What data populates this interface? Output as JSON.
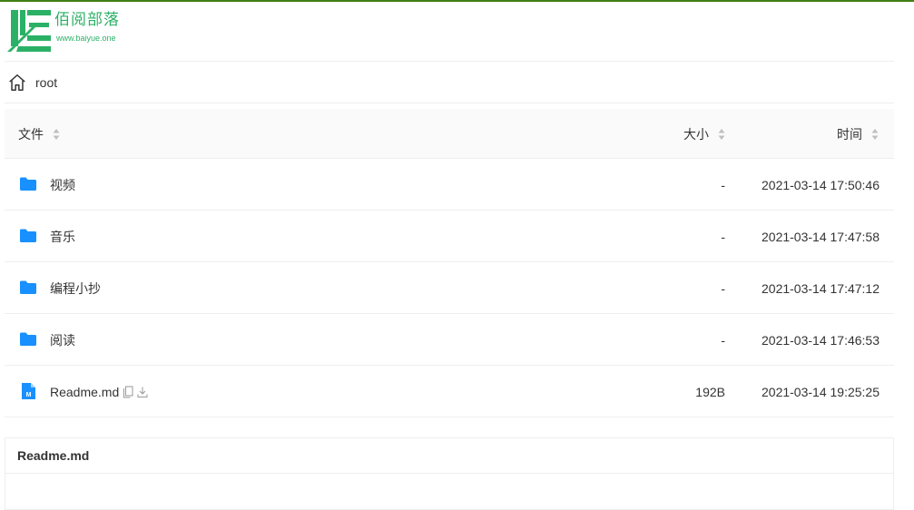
{
  "site": {
    "logo_text": "佰阅部落",
    "logo_url": "www.baiyue.one",
    "brand_color": "#2bb166",
    "top_bar_color": "#3f7f14"
  },
  "breadcrumb": {
    "icon": "home-icon",
    "items": [
      "root"
    ]
  },
  "table": {
    "headers": {
      "name": "文件",
      "size": "大小",
      "time": "时间"
    },
    "rows": [
      {
        "type": "folder",
        "icon": "folder-icon",
        "name": "视频",
        "size": "-",
        "time": "2021-03-14 17:50:46"
      },
      {
        "type": "folder",
        "icon": "folder-icon",
        "name": "音乐",
        "size": "-",
        "time": "2021-03-14 17:47:58"
      },
      {
        "type": "folder",
        "icon": "folder-icon",
        "name": "编程小抄",
        "size": "-",
        "time": "2021-03-14 17:47:12"
      },
      {
        "type": "folder",
        "icon": "folder-icon",
        "name": "阅读",
        "size": "-",
        "time": "2021-03-14 17:46:53"
      },
      {
        "type": "file",
        "icon": "markdown-file-icon",
        "name": "Readme.md",
        "size": "192B",
        "time": "2021-03-14 19:25:25",
        "actions": [
          "copy-icon",
          "download-icon"
        ]
      }
    ],
    "folder_color": "#1890ff"
  },
  "readme": {
    "title": "Readme.md"
  }
}
